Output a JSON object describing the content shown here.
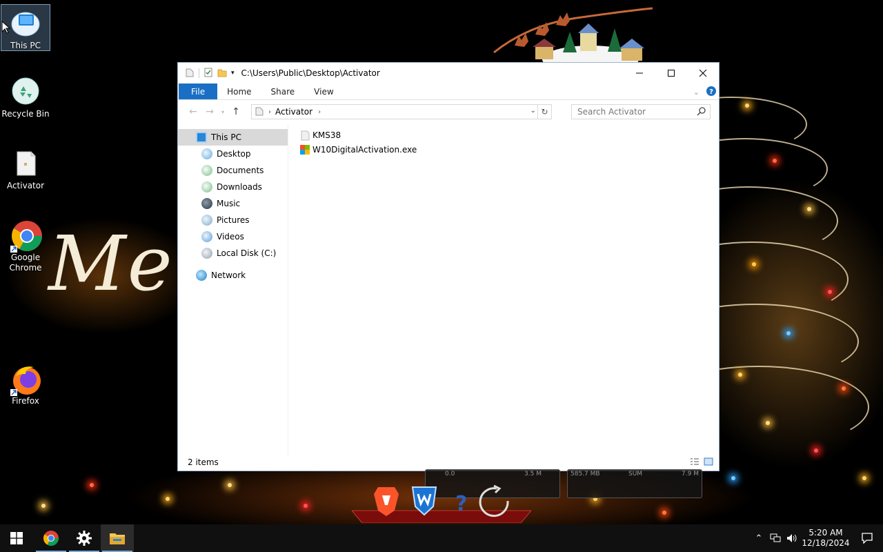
{
  "desktop": {
    "wallpaper_text": "Mer",
    "icons": [
      {
        "label": "This PC"
      },
      {
        "label": "Recycle Bin"
      },
      {
        "label": "Activator"
      },
      {
        "label": "Google Chrome"
      },
      {
        "label": "Firefox"
      }
    ]
  },
  "explorer": {
    "title_path": "C:\\Users\\Public\\Desktop\\Activator",
    "ribbon_tabs": [
      "File",
      "Home",
      "Share",
      "View"
    ],
    "address": {
      "crumb": "Activator"
    },
    "search": {
      "placeholder": "Search Activator"
    },
    "nav_pane": {
      "this_pc": "This PC",
      "children": [
        "Desktop",
        "Documents",
        "Downloads",
        "Music",
        "Pictures",
        "Videos",
        "Local Disk (C:)"
      ],
      "network": "Network"
    },
    "items": [
      {
        "name": "KMS38",
        "type": "folder"
      },
      {
        "name": "W10DigitalActivation.exe",
        "type": "application"
      }
    ],
    "status": "2 items"
  },
  "meters": {
    "left_a": "0.0",
    "left_b": "3.5 M",
    "right_a": "585.7 MB",
    "right_b": "SUM",
    "right_c": "7.9 M"
  },
  "taskbar": {
    "time": "5:20 AM",
    "date": "12/18/2024"
  },
  "colors": {
    "accent": "#1a6fc4",
    "selection": "#d9d9d9",
    "taskbar": "#101010",
    "folder": "#f4c65b"
  }
}
